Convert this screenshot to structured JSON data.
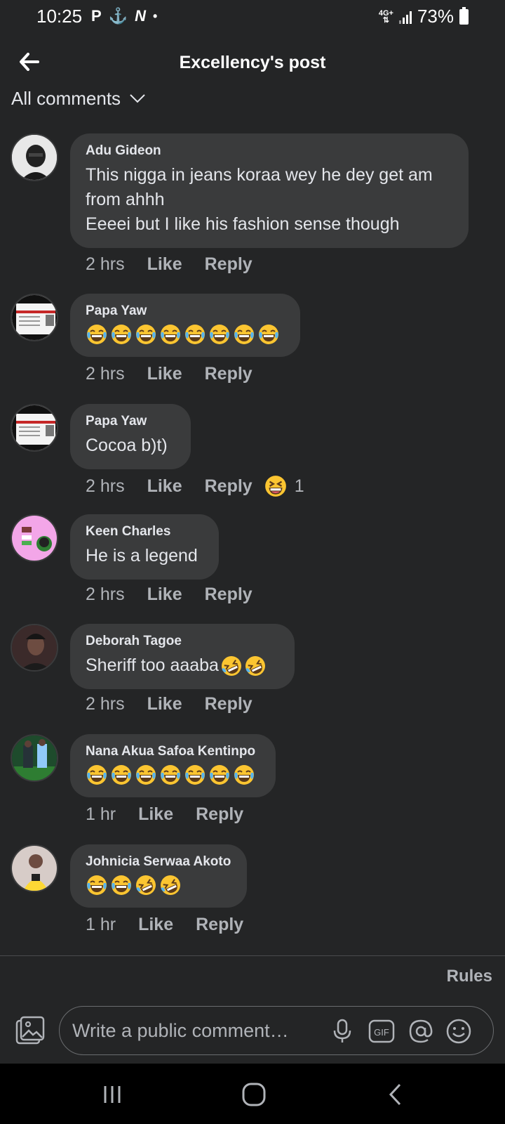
{
  "status_bar": {
    "time": "10:25",
    "left_icons": [
      "P",
      "⚓",
      "N",
      "•"
    ],
    "network": "4G+",
    "battery": "73%"
  },
  "header": {
    "title": "Excellency's post"
  },
  "filter": {
    "label": "All comments"
  },
  "comments": [
    {
      "author": "Adu Gideon",
      "text": "This nigga in jeans koraa wey he dey get am\nfrom ahhh\nEeeei but I like his fashion sense though",
      "time": "2 hrs",
      "like": "Like",
      "reply": "Reply"
    },
    {
      "author": "Papa Yaw",
      "emojis": [
        "tears-of-joy",
        "tears-of-joy",
        "tears-of-joy",
        "tears-of-joy",
        "tears-of-joy",
        "tears-of-joy",
        "tears-of-joy",
        "tears-of-joy"
      ],
      "time": "2 hrs",
      "like": "Like",
      "reply": "Reply"
    },
    {
      "author": "Papa Yaw",
      "text": "Cocoa b)t)",
      "time": "2 hrs",
      "like": "Like",
      "reply": "Reply",
      "reaction_count": "1"
    },
    {
      "author": "Keen Charles",
      "text": "He is a legend",
      "time": "2 hrs",
      "like": "Like",
      "reply": "Reply"
    },
    {
      "author": "Deborah Tagoe",
      "text": "Sheriff too aaaba",
      "time": "2 hrs",
      "like": "Like",
      "reply": "Reply"
    },
    {
      "author": "Nana Akua Safoa Kentinpo",
      "emojis": [
        "tears-of-joy",
        "tears-of-joy",
        "tears-of-joy",
        "tears-of-joy",
        "tears-of-joy",
        "tears-of-joy",
        "tears-of-joy"
      ],
      "time": "1 hr",
      "like": "Like",
      "reply": "Reply"
    },
    {
      "author": "Johnicia Serwaa Akoto",
      "emojis": [
        "tears-of-joy",
        "tears-of-joy",
        "rolling-laughing",
        "rolling-laughing"
      ],
      "time": "1 hr",
      "like": "Like",
      "reply": "Reply"
    }
  ],
  "footer": {
    "rules": "Rules",
    "placeholder": "Write a public comment…"
  },
  "colors": {
    "background": "#242526",
    "bubble": "#3a3b3c",
    "secondary_text": "#b0b3b8",
    "emoji_yellow": "#fbc531",
    "tears_blue": "#56b4ef"
  }
}
